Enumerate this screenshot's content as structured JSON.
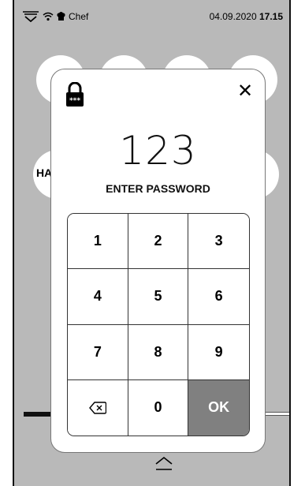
{
  "status_bar": {
    "profile_label": "Chef",
    "date": "04.09.2020",
    "time": "17.15"
  },
  "background": {
    "partial_text": "HA"
  },
  "password_dialog": {
    "lock_icon_text": "***",
    "entered_value": "123",
    "prompt_label": "ENTER PASSWORD",
    "close_icon": "close-icon"
  },
  "keypad": {
    "keys": [
      "1",
      "2",
      "3",
      "4",
      "5",
      "6",
      "7",
      "8",
      "9",
      "",
      "0",
      "OK"
    ],
    "backspace_icon": "backspace-icon"
  }
}
